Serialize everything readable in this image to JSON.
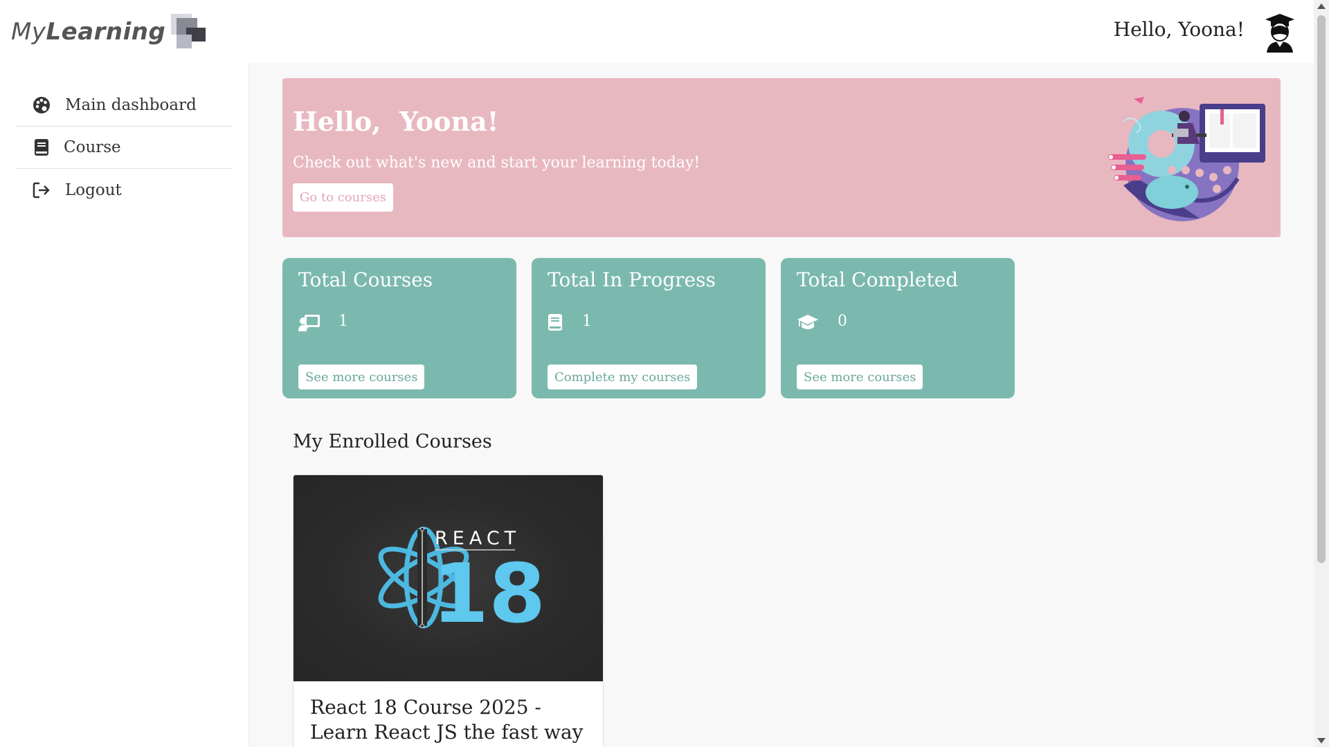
{
  "header": {
    "logo_text_my": "My",
    "logo_text_learning": "Learning",
    "greeting": "Hello, Yoona!",
    "avatar_icon": "student-graduate-icon"
  },
  "sidebar": {
    "items": [
      {
        "label": "Main dashboard",
        "icon": "palette-icon"
      },
      {
        "label": "Course",
        "icon": "book-icon"
      },
      {
        "label": "Logout",
        "icon": "logout-icon"
      }
    ]
  },
  "hero": {
    "title": "Hello,  Yoona!",
    "subtitle": "Check out what's new and start your learning today!",
    "button_label": "Go to courses",
    "background_color": "#e8b8c0"
  },
  "stats": [
    {
      "title": "Total Courses",
      "icon": "chalkboard-teacher-icon",
      "value": "1",
      "button_label": "See more courses"
    },
    {
      "title": "Total In Progress",
      "icon": "book-icon",
      "value": "1",
      "button_label": "Complete my courses"
    },
    {
      "title": "Total Completed",
      "icon": "graduation-cap-icon",
      "value": "0",
      "button_label": "See more courses"
    }
  ],
  "stat_card_color": "#7bb9ae",
  "enrolled": {
    "section_title": "My Enrolled Courses",
    "courses": [
      {
        "name": "React 18 Course 2025 - Learn React JS the fast way",
        "thumb_word": "REACT",
        "thumb_number": "18"
      }
    ]
  }
}
